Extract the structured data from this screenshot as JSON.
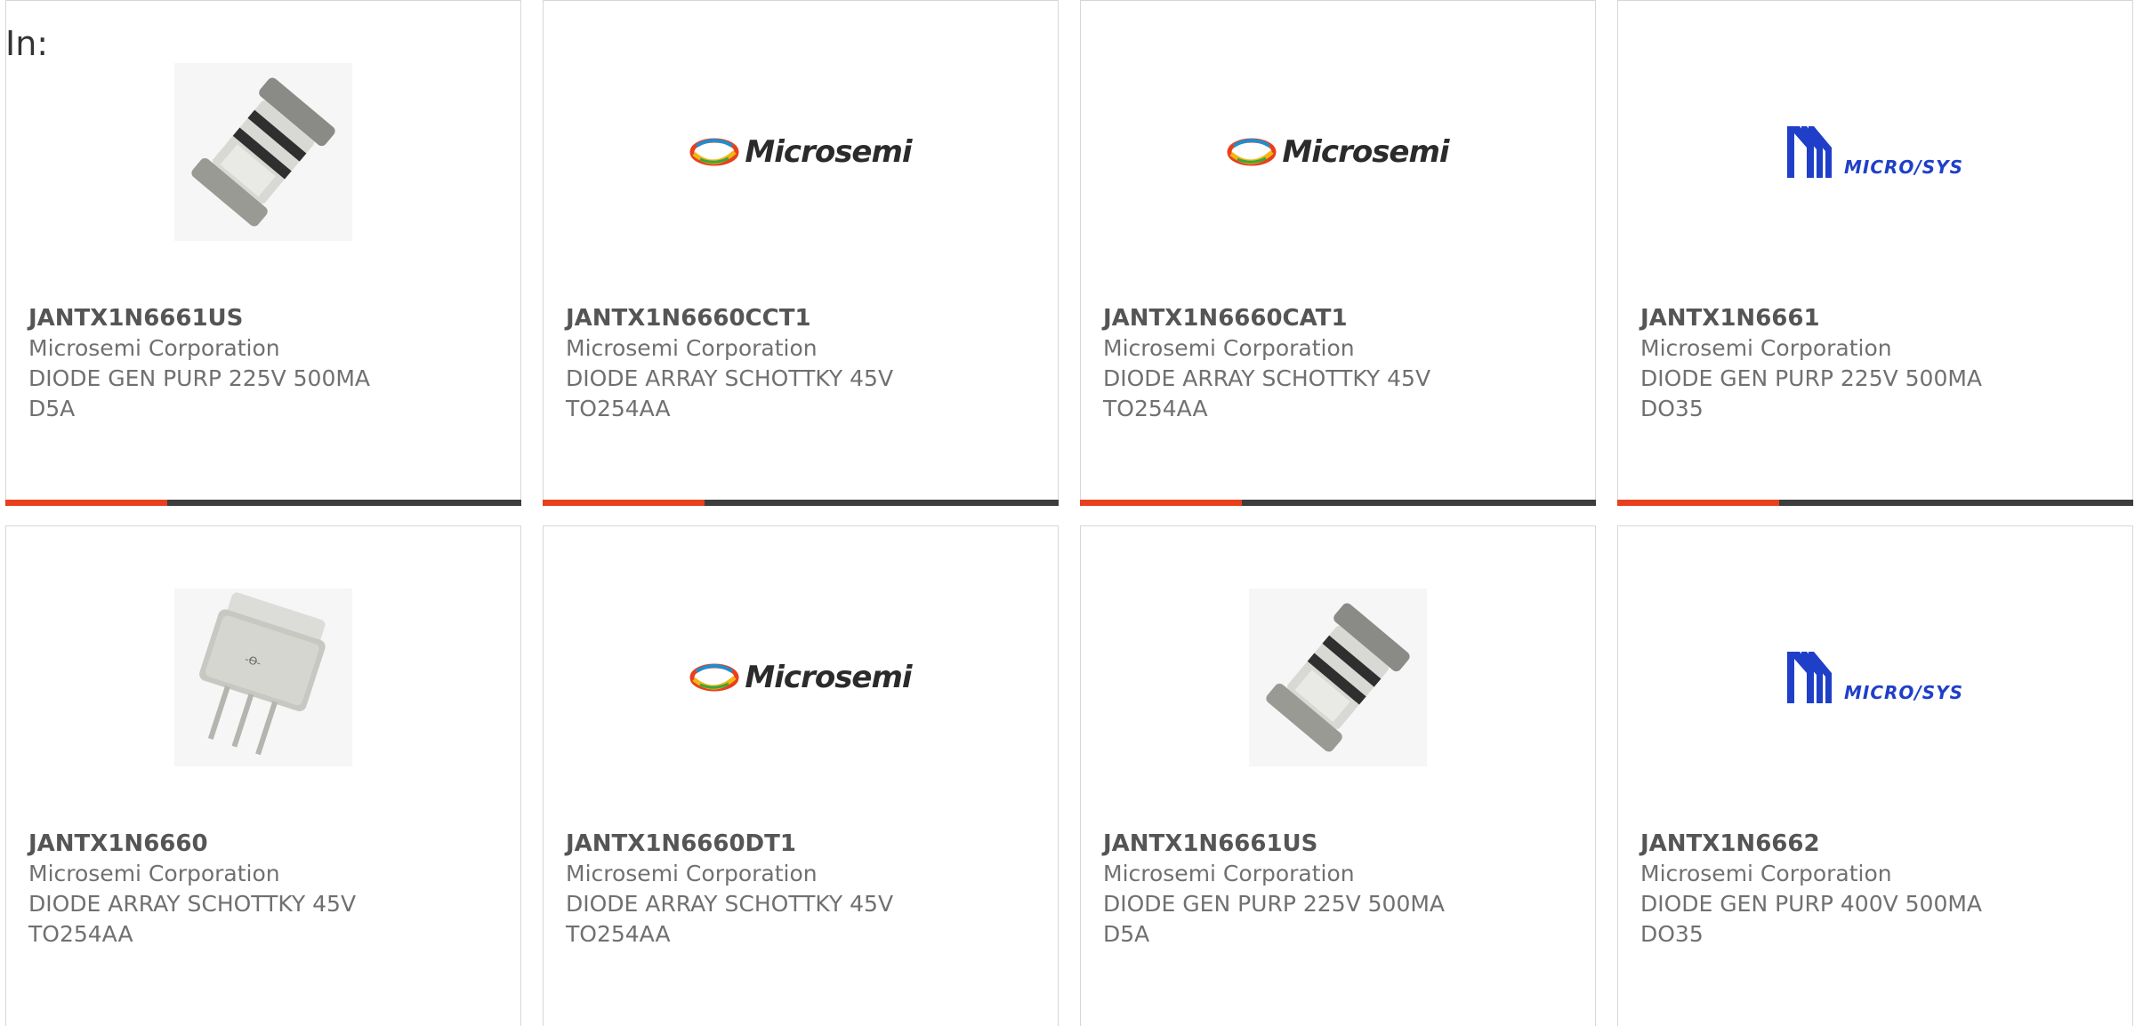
{
  "header": {
    "label": "In:"
  },
  "colors": {
    "accent": "#e8401c",
    "bar": "#3d3d3d",
    "microsys_blue": "#1f3fc9"
  },
  "products": [
    {
      "part": "JANTX1N6661US",
      "manufacturer": "Microsemi Corporation",
      "description": "DIODE GEN PURP 225V 500MA\nD5A",
      "image": "diode-d5a-image"
    },
    {
      "part": "JANTX1N6660CCT1",
      "manufacturer": "Microsemi Corporation",
      "description": "DIODE ARRAY SCHOTTKY 45V\nTO254AA",
      "image": "microsemi-logo",
      "logo_text": "Microsemi"
    },
    {
      "part": "JANTX1N6660CAT1",
      "manufacturer": "Microsemi Corporation",
      "description": "DIODE ARRAY SCHOTTKY 45V\nTO254AA",
      "image": "microsemi-logo",
      "logo_text": "Microsemi"
    },
    {
      "part": "JANTX1N6661",
      "manufacturer": "Microsemi Corporation",
      "description": "DIODE GEN PURP 225V 500MA\nDO35",
      "image": "microsys-logo",
      "logo_text": "MICRO/SYS"
    },
    {
      "part": "JANTX1N6660",
      "manufacturer": "Microsemi Corporation",
      "description": "DIODE ARRAY SCHOTTKY 45V\nTO254AA",
      "image": "to254-package-image"
    },
    {
      "part": "JANTX1N6660DT1",
      "manufacturer": "Microsemi Corporation",
      "description": "DIODE ARRAY SCHOTTKY 45V\nTO254AA",
      "image": "microsemi-logo",
      "logo_text": "Microsemi"
    },
    {
      "part": "JANTX1N6661US",
      "manufacturer": "Microsemi Corporation",
      "description": "DIODE GEN PURP 225V 500MA\nD5A",
      "image": "diode-d5a-image"
    },
    {
      "part": "JANTX1N6662",
      "manufacturer": "Microsemi Corporation",
      "description": "DIODE GEN PURP 400V 500MA\nDO35",
      "image": "microsys-logo",
      "logo_text": "MICRO/SYS"
    }
  ]
}
